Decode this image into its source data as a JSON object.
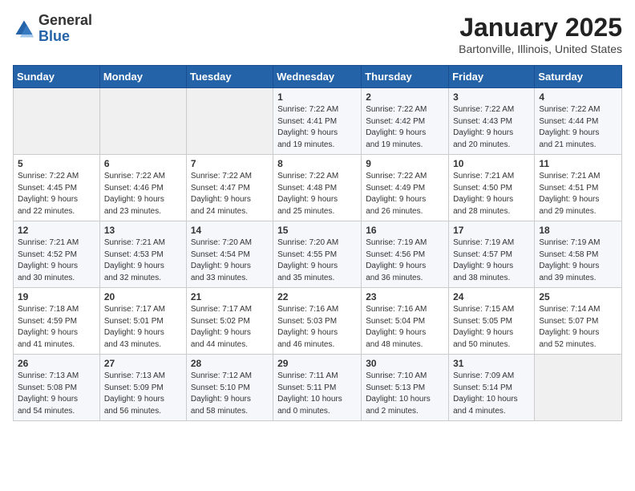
{
  "header": {
    "logo_general": "General",
    "logo_blue": "Blue",
    "month_title": "January 2025",
    "location": "Bartonville, Illinois, United States"
  },
  "weekdays": [
    "Sunday",
    "Monday",
    "Tuesday",
    "Wednesday",
    "Thursday",
    "Friday",
    "Saturday"
  ],
  "weeks": [
    [
      {
        "day": "",
        "info": ""
      },
      {
        "day": "",
        "info": ""
      },
      {
        "day": "",
        "info": ""
      },
      {
        "day": "1",
        "info": "Sunrise: 7:22 AM\nSunset: 4:41 PM\nDaylight: 9 hours\nand 19 minutes."
      },
      {
        "day": "2",
        "info": "Sunrise: 7:22 AM\nSunset: 4:42 PM\nDaylight: 9 hours\nand 19 minutes."
      },
      {
        "day": "3",
        "info": "Sunrise: 7:22 AM\nSunset: 4:43 PM\nDaylight: 9 hours\nand 20 minutes."
      },
      {
        "day": "4",
        "info": "Sunrise: 7:22 AM\nSunset: 4:44 PM\nDaylight: 9 hours\nand 21 minutes."
      }
    ],
    [
      {
        "day": "5",
        "info": "Sunrise: 7:22 AM\nSunset: 4:45 PM\nDaylight: 9 hours\nand 22 minutes."
      },
      {
        "day": "6",
        "info": "Sunrise: 7:22 AM\nSunset: 4:46 PM\nDaylight: 9 hours\nand 23 minutes."
      },
      {
        "day": "7",
        "info": "Sunrise: 7:22 AM\nSunset: 4:47 PM\nDaylight: 9 hours\nand 24 minutes."
      },
      {
        "day": "8",
        "info": "Sunrise: 7:22 AM\nSunset: 4:48 PM\nDaylight: 9 hours\nand 25 minutes."
      },
      {
        "day": "9",
        "info": "Sunrise: 7:22 AM\nSunset: 4:49 PM\nDaylight: 9 hours\nand 26 minutes."
      },
      {
        "day": "10",
        "info": "Sunrise: 7:21 AM\nSunset: 4:50 PM\nDaylight: 9 hours\nand 28 minutes."
      },
      {
        "day": "11",
        "info": "Sunrise: 7:21 AM\nSunset: 4:51 PM\nDaylight: 9 hours\nand 29 minutes."
      }
    ],
    [
      {
        "day": "12",
        "info": "Sunrise: 7:21 AM\nSunset: 4:52 PM\nDaylight: 9 hours\nand 30 minutes."
      },
      {
        "day": "13",
        "info": "Sunrise: 7:21 AM\nSunset: 4:53 PM\nDaylight: 9 hours\nand 32 minutes."
      },
      {
        "day": "14",
        "info": "Sunrise: 7:20 AM\nSunset: 4:54 PM\nDaylight: 9 hours\nand 33 minutes."
      },
      {
        "day": "15",
        "info": "Sunrise: 7:20 AM\nSunset: 4:55 PM\nDaylight: 9 hours\nand 35 minutes."
      },
      {
        "day": "16",
        "info": "Sunrise: 7:19 AM\nSunset: 4:56 PM\nDaylight: 9 hours\nand 36 minutes."
      },
      {
        "day": "17",
        "info": "Sunrise: 7:19 AM\nSunset: 4:57 PM\nDaylight: 9 hours\nand 38 minutes."
      },
      {
        "day": "18",
        "info": "Sunrise: 7:19 AM\nSunset: 4:58 PM\nDaylight: 9 hours\nand 39 minutes."
      }
    ],
    [
      {
        "day": "19",
        "info": "Sunrise: 7:18 AM\nSunset: 4:59 PM\nDaylight: 9 hours\nand 41 minutes."
      },
      {
        "day": "20",
        "info": "Sunrise: 7:17 AM\nSunset: 5:01 PM\nDaylight: 9 hours\nand 43 minutes."
      },
      {
        "day": "21",
        "info": "Sunrise: 7:17 AM\nSunset: 5:02 PM\nDaylight: 9 hours\nand 44 minutes."
      },
      {
        "day": "22",
        "info": "Sunrise: 7:16 AM\nSunset: 5:03 PM\nDaylight: 9 hours\nand 46 minutes."
      },
      {
        "day": "23",
        "info": "Sunrise: 7:16 AM\nSunset: 5:04 PM\nDaylight: 9 hours\nand 48 minutes."
      },
      {
        "day": "24",
        "info": "Sunrise: 7:15 AM\nSunset: 5:05 PM\nDaylight: 9 hours\nand 50 minutes."
      },
      {
        "day": "25",
        "info": "Sunrise: 7:14 AM\nSunset: 5:07 PM\nDaylight: 9 hours\nand 52 minutes."
      }
    ],
    [
      {
        "day": "26",
        "info": "Sunrise: 7:13 AM\nSunset: 5:08 PM\nDaylight: 9 hours\nand 54 minutes."
      },
      {
        "day": "27",
        "info": "Sunrise: 7:13 AM\nSunset: 5:09 PM\nDaylight: 9 hours\nand 56 minutes."
      },
      {
        "day": "28",
        "info": "Sunrise: 7:12 AM\nSunset: 5:10 PM\nDaylight: 9 hours\nand 58 minutes."
      },
      {
        "day": "29",
        "info": "Sunrise: 7:11 AM\nSunset: 5:11 PM\nDaylight: 10 hours\nand 0 minutes."
      },
      {
        "day": "30",
        "info": "Sunrise: 7:10 AM\nSunset: 5:13 PM\nDaylight: 10 hours\nand 2 minutes."
      },
      {
        "day": "31",
        "info": "Sunrise: 7:09 AM\nSunset: 5:14 PM\nDaylight: 10 hours\nand 4 minutes."
      },
      {
        "day": "",
        "info": ""
      }
    ]
  ]
}
